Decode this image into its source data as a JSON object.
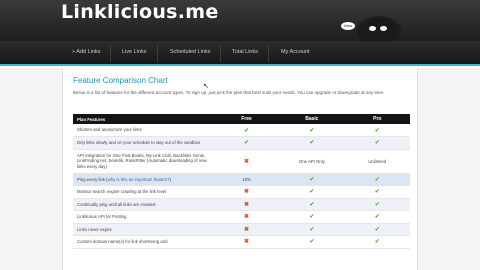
{
  "header": {
    "logo_text": "Linklicious.me",
    "mascot_bubble": "links"
  },
  "nav": {
    "items": [
      "» Add Links",
      "Live Links",
      "Scheduled Links",
      "Total Links",
      "My Account"
    ]
  },
  "main": {
    "title": "Feature Comparison Chart",
    "intro": "Below is a list of features for the different account types. To sign up, just pick the plan that best suits your needs. You can upgrade or downgrade at any time.",
    "table": {
      "headers": [
        "Plan Features",
        "Free",
        "Basic",
        "Pro"
      ],
      "rows": [
        {
          "feature": "Shorten and anonymize your links",
          "free": "✔",
          "basic": "✔",
          "pro": "✔"
        },
        {
          "feature": "Drip links slowly and on your schedule to stay out of the sandbox",
          "free": "✔",
          "basic": "✔",
          "pro": "✔"
        },
        {
          "feature": "API integration for One Post Books, My Link Club, Backlinks Genie, LinkFinding.net, SeoKlik, RankRitter (Automatic downloading of new links every day)",
          "free": "✖",
          "basic": "One API Only",
          "pro": "Unlimited"
        },
        {
          "feature_pre": "Ping every link (",
          "feature_link": "why is this an important feature?",
          "feature_post": ")",
          "free": "10%",
          "basic": "✔",
          "pro": "✔"
        },
        {
          "feature": "Monitor search engine crawling at the link level",
          "free": "✖",
          "basic": "✔",
          "pro": "✔"
        },
        {
          "feature": "Continually ping until all links are crawled",
          "free": "✖",
          "basic": "✔",
          "pro": "✔"
        },
        {
          "feature": "Linklicious API for Posting",
          "free": "✖",
          "basic": "✔",
          "pro": "✔"
        },
        {
          "feature": "Links never expire",
          "free": "✖",
          "basic": "✔",
          "pro": "✔"
        },
        {
          "feature": "Custom domain name(s) for link shortening and",
          "free": "✖",
          "basic": "✔",
          "pro": "✔"
        }
      ]
    }
  }
}
